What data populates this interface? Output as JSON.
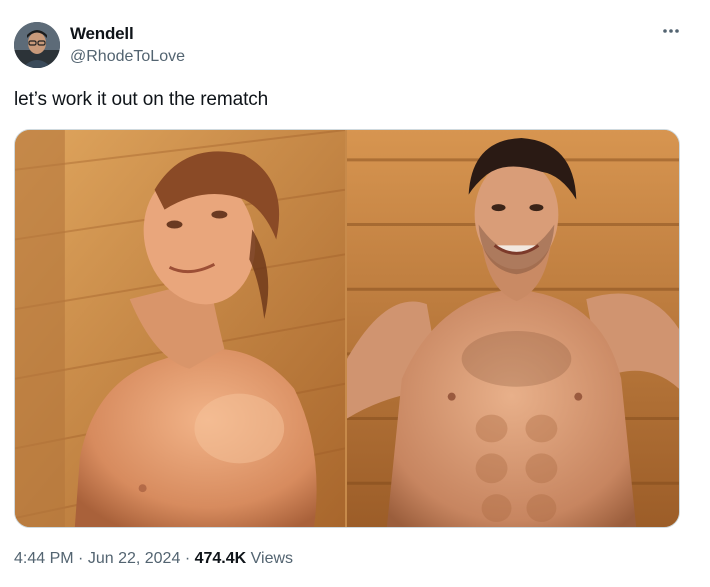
{
  "author": {
    "name": "Wendell",
    "handle": "@RhodeToLove",
    "avatar_icon": "avatar-photo"
  },
  "tweet": {
    "text": "let’s work it out on the rematch"
  },
  "media": {
    "count": 2,
    "images": [
      {
        "icon": "sauna-photo-redhead-man"
      },
      {
        "icon": "sauna-photo-curly-hair-man"
      }
    ]
  },
  "meta": {
    "time": "4:44 PM",
    "separator": "·",
    "date": "Jun 22, 2024",
    "views_count": "474.4K",
    "views_label": "Views"
  },
  "colors": {
    "text": "#0f1419",
    "secondary": "#536471",
    "border": "#cfd9de",
    "background": "#ffffff"
  }
}
